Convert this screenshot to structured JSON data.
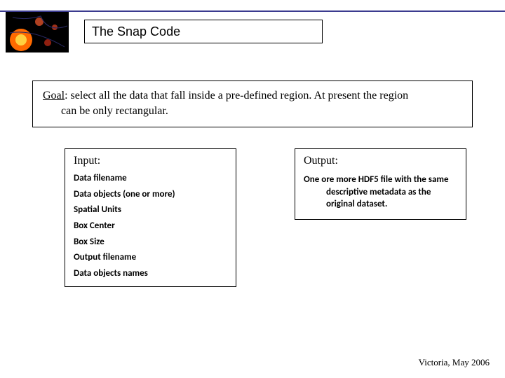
{
  "header": {
    "title": "The Snap Code"
  },
  "goal": {
    "label": "Goal",
    "line1_after": ": select all the data that fall inside a pre-defined region. At present the region",
    "line2": "can be only rectangular."
  },
  "input": {
    "title": "Input:",
    "items": [
      "Data filename",
      "Data objects (one or more)",
      "Spatial Units",
      "Box Center",
      "Box Size",
      "Output filename",
      "Data objects names"
    ]
  },
  "output": {
    "title": "Output:",
    "first": "One ore more HDF5 file with the same",
    "cont1": "descriptive metadata as the",
    "cont2": "original dataset."
  },
  "footer": "Victoria, May 2006",
  "colors": {
    "divider": "#3b3b8f"
  }
}
